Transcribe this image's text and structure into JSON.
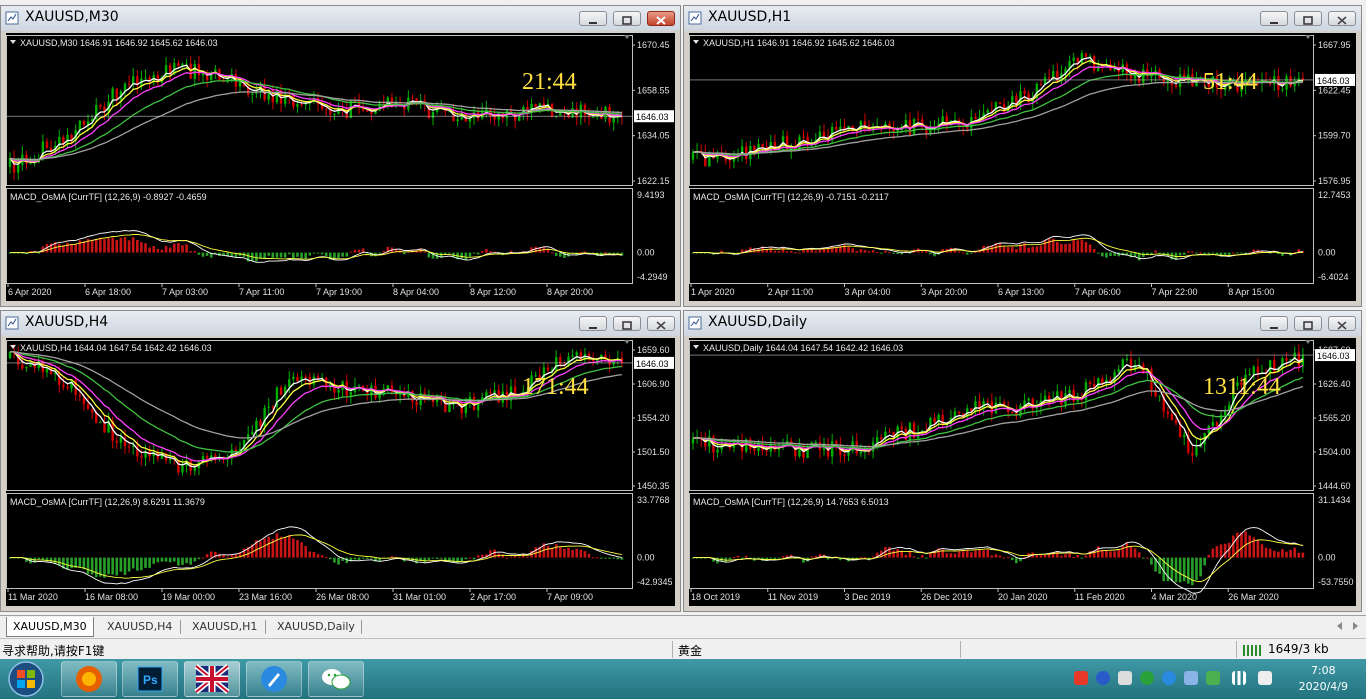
{
  "windows": [
    {
      "title": "XAUUSD,M30",
      "info": "XAUUSD,M30  1646.91 1646.92 1645.62 1646.03",
      "price_labels": [
        "1670.45",
        "1658.55",
        "1634.05",
        "1622.15"
      ],
      "current_price": "1646.03",
      "countdown": "21:44",
      "macd_label": "MACD_OsMA [CurrTF] (12,26,9) -0.8927 -0.4659",
      "macd_scale": [
        "9.4193",
        "0.00",
        "-4.2949"
      ],
      "time_labels": [
        "6 Apr 2020",
        "6 Apr 18:00",
        "7 Apr 03:00",
        "7 Apr 11:00",
        "7 Apr 19:00",
        "8 Apr 04:00",
        "8 Apr 12:00",
        "8 Apr 20:00"
      ],
      "active": true
    },
    {
      "title": "XAUUSD,H1",
      "info": "XAUUSD,H1  1646.91 1646.92 1645.62 1646.03",
      "price_labels": [
        "1667.95",
        "1622.45",
        "1599.70",
        "1576.95"
      ],
      "current_price": "1646.03",
      "countdown": "51:44",
      "macd_label": "MACD_OsMA [CurrTF] (12,26,9) -0.7151 -0.2117",
      "macd_scale": [
        "12.7453",
        "0.00",
        "-6.4024"
      ],
      "time_labels": [
        "1 Apr 2020",
        "2 Apr 11:00",
        "3 Apr 04:00",
        "3 Apr 20:00",
        "6 Apr 13:00",
        "7 Apr 06:00",
        "7 Apr 22:00",
        "8 Apr 15:00"
      ],
      "active": false
    },
    {
      "title": "XAUUSD,H4",
      "info": "XAUUSD,H4  1644.04 1647.54 1642.42 1646.03",
      "price_labels": [
        "1659.60",
        "1606.90",
        "1554.20",
        "1501.50",
        "1450.35"
      ],
      "current_price": "1646.03",
      "countdown": "171:44",
      "macd_label": "MACD_OsMA [CurrTF] (12,26,9) 8.6291 11.3679",
      "macd_scale": [
        "33.7768",
        "0.00",
        "-42.9345"
      ],
      "time_labels": [
        "11 Mar 2020",
        "16 Mar 08:00",
        "19 Mar 00:00",
        "23 Mar 16:00",
        "26 Mar 08:00",
        "31 Mar 01:00",
        "2 Apr 17:00",
        "7 Apr 09:00"
      ],
      "active": false
    },
    {
      "title": "XAUUSD,Daily",
      "info": "XAUUSD,Daily  1644.04 1647.54 1642.42 1646.03",
      "price_labels": [
        "1687.60",
        "1626.40",
        "1565.20",
        "1504.00",
        "1444.60"
      ],
      "current_price": "1646.03",
      "countdown": "1311:44",
      "macd_label": "MACD_OsMA [CurrTF] (12,26,9) 14.7653 6.5013",
      "macd_scale": [
        "31.1434",
        "0.00",
        "-53.7550"
      ],
      "time_labels": [
        "18 Oct 2019",
        "11 Nov 2019",
        "3 Dec 2019",
        "26 Dec 2019",
        "20 Jan 2020",
        "11 Feb 2020",
        "4 Mar 2020",
        "26 Mar 2020"
      ],
      "active": false
    }
  ],
  "tabs": [
    "XAUUSD,M30",
    "XAUUSD,H4",
    "XAUUSD,H1",
    "XAUUSD,Daily"
  ],
  "status": {
    "help": "寻求帮助,请按F1键",
    "profile": "黄金",
    "traffic": "1649/3 kb"
  },
  "clock": {
    "time": "7:08",
    "date": "2020/4/9"
  },
  "colors": {
    "bull": "#00b000",
    "bear": "#d40000",
    "ma_fast": "#ffffff",
    "ma_2": "#ffff40",
    "ma_3": "#ff40ff",
    "ma_4": "#40c040",
    "ma_5": "#a0a0a0",
    "countdown": "#ffe040",
    "macd_pos": "#c81414",
    "macd_neg": "#28a028"
  },
  "icons": [
    "start-orb-icon",
    "firefox-icon",
    "photoshop-icon",
    "uk-flag-icon",
    "pen-icon",
    "wechat-icon"
  ]
}
